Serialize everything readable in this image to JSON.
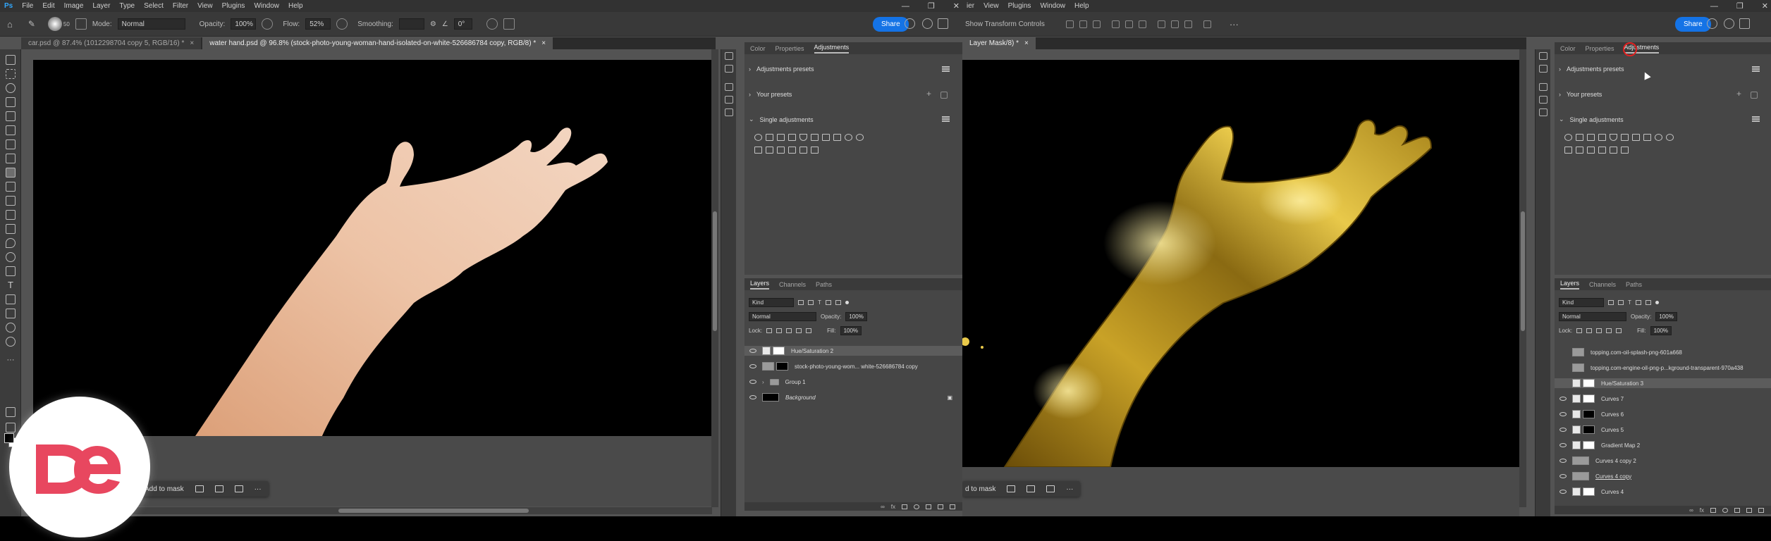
{
  "left": {
    "menu": [
      "Ps",
      "File",
      "Edit",
      "Image",
      "Layer",
      "Type",
      "Select",
      "Filter",
      "View",
      "Plugins",
      "Window",
      "Help"
    ],
    "options": {
      "mode_label": "Mode:",
      "mode_value": "Normal",
      "opacity_label": "Opacity:",
      "opacity_value": "100%",
      "flow_label": "Flow:",
      "flow_value": "52%",
      "smoothing_label": "Smoothing:",
      "angle_value": "0°",
      "brush_size": "50"
    },
    "share": "Share",
    "tabs": [
      {
        "label": "car.psd @ 87.4% (1012298704 copy 5, RGB/16) *"
      },
      {
        "label": "water hand.psd @ 96.8% (stock-photo-young-woman-hand-isolated-on-white-526686784 copy, RGB/8) *"
      }
    ],
    "context_bar": {
      "label": "Add to mask",
      "more": "···"
    },
    "panel_tabs": [
      "Color",
      "Properties",
      "Adjustments"
    ],
    "sections": {
      "presets": "Adjustments presets",
      "your": "Your presets",
      "single": "Single adjustments"
    },
    "layer_tabs": [
      "Layers",
      "Channels",
      "Paths"
    ],
    "kind": "Kind",
    "blend": "Normal",
    "opacity_label": "Opacity:",
    "opacity": "100%",
    "lock": "Lock:",
    "fill_label": "Fill:",
    "fill": "100%",
    "layers": [
      {
        "name": "Hue/Saturation 2",
        "thumb": "adj",
        "selected": true
      },
      {
        "name": "stock-photo-young-wom... white-526686784 copy",
        "thumb": "blk",
        "selected": false
      },
      {
        "name": "Group 1",
        "thumb": "folder",
        "selected": false
      },
      {
        "name": "Background",
        "thumb": "blk",
        "selected": false
      }
    ]
  },
  "right": {
    "menu": [
      "ier",
      "View",
      "Plugins",
      "Window",
      "Help"
    ],
    "options": {
      "transform": "Show Transform Controls"
    },
    "share": "Share",
    "tabs": [
      {
        "label": "Layer Mask/8) *"
      }
    ],
    "context_bar": {
      "label": "d to mask",
      "more": "···"
    },
    "panel_tabs": [
      "Color",
      "Properties",
      "Adjustments"
    ],
    "sections": {
      "presets": "Adjustments presets",
      "your": "Your presets",
      "single": "Single adjustments"
    },
    "layer_tabs": [
      "Layers",
      "Channels",
      "Paths"
    ],
    "kind": "Kind",
    "blend": "Normal",
    "opacity_label": "Opacity:",
    "opacity": "100%",
    "lock": "Lock:",
    "fill_label": "Fill:",
    "fill": "100%",
    "layers": [
      {
        "name": "topping.com-oil-splash-png-601a668",
        "thumb": "gy",
        "selected": false
      },
      {
        "name": "topping.com-engine-oil-png-p...kground-transparent-970a438",
        "thumb": "gy",
        "selected": false
      },
      {
        "name": "Hue/Saturation 3",
        "thumb": "adj",
        "selected": true
      },
      {
        "name": "Curves 7",
        "thumb": "adj",
        "selected": false
      },
      {
        "name": "Curves 6",
        "thumb": "blk",
        "selected": false
      },
      {
        "name": "Curves 5",
        "thumb": "blk",
        "selected": false
      },
      {
        "name": "Gradient Map 2",
        "thumb": "adj",
        "selected": false
      },
      {
        "name": "Curves 4 copy 2",
        "thumb": "gy",
        "selected": false
      },
      {
        "name": "Curves 4 copy",
        "thumb": "gy",
        "selected": false
      },
      {
        "name": "Curves 4",
        "thumb": "adj",
        "selected": false
      }
    ]
  },
  "colors": {
    "accent": "#1473e6",
    "logo": "#e8475f",
    "gold": "#c9a227"
  }
}
